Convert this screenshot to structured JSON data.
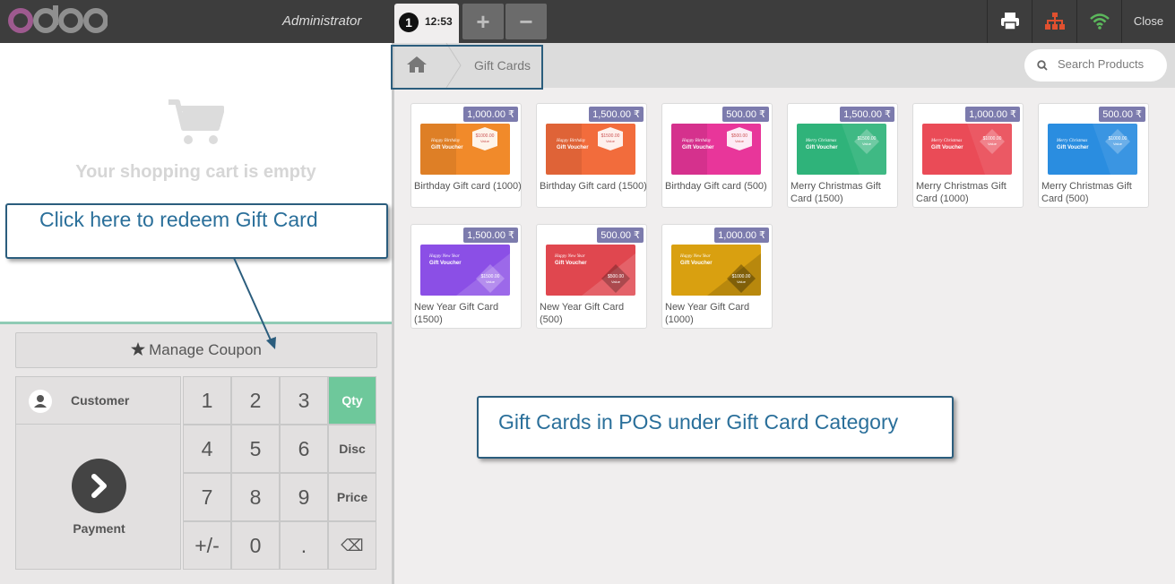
{
  "topbar": {
    "logo_text": "odoo",
    "user": "Administrator",
    "order_number": "1",
    "order_time": "12:53",
    "add_order": "+",
    "remove_order": "−",
    "close_label": "Close"
  },
  "cart": {
    "empty_message": "Your shopping cart is empty"
  },
  "controls": {
    "coupon_label": "Manage Coupon",
    "customer_label": "Customer",
    "payment_label": "Payment",
    "keys": [
      "1",
      "2",
      "3",
      "Qty",
      "4",
      "5",
      "6",
      "Disc",
      "7",
      "8",
      "9",
      "Price",
      "+/-",
      "0",
      ".",
      "⌫"
    ]
  },
  "breadcrumb": {
    "category": "Gift Cards"
  },
  "search": {
    "placeholder": "Search Products"
  },
  "products": [
    {
      "name": "Birthday Gift card (1000)",
      "price": "1,000.00 ₹",
      "theme": "Happy Birthday",
      "value": "$1000.00",
      "color": "#f18a2a"
    },
    {
      "name": "Birthday Gift card (1500)",
      "price": "1,500.00 ₹",
      "theme": "Happy Birthday",
      "value": "$1500.00",
      "color": "#f26c3c"
    },
    {
      "name": "Birthday Gift card (500)",
      "price": "500.00 ₹",
      "theme": "Happy Birthday",
      "value": "$500.00",
      "color": "#e8369a"
    },
    {
      "name": "Merry Christmas Gift Card (1500)",
      "price": "1,500.00 ₹",
      "theme": "Merry Christmas",
      "value": "$1500.00",
      "color": "#2fb37a"
    },
    {
      "name": "Merry Christmas Gift Card (1000)",
      "price": "1,000.00 ₹",
      "theme": "Merry Christmas",
      "value": "$1000.00",
      "color": "#ea4b57"
    },
    {
      "name": "Merry Christmas Gift Card (500)",
      "price": "500.00 ₹",
      "theme": "Merry Christmas",
      "value": "$1000.00",
      "color": "#2a8de0"
    },
    {
      "name": "New Year Gift Card (1500)",
      "price": "1,500.00 ₹",
      "theme": "Happy New Year",
      "value": "$1500.00",
      "color": "#8b4fe6"
    },
    {
      "name": "New Year Gift Card (500)",
      "price": "500.00 ₹",
      "theme": "Happy New Year",
      "value": "$500.00",
      "color": "#e0474f"
    },
    {
      "name": "New Year Gift Card (1000)",
      "price": "1,000.00 ₹",
      "theme": "Happy New Year",
      "value": "$1000.00",
      "color": "#d9a010"
    }
  ],
  "annotations": {
    "redeem": "Click here to redeem Gift Card",
    "category": "Gift Cards in POS under Gift Card Category"
  },
  "colors": {
    "accent": "#6ec89b",
    "price_tag": "#7c7bad",
    "annotation_border": "#2b5d7d",
    "logo": "#9e5a8f"
  }
}
